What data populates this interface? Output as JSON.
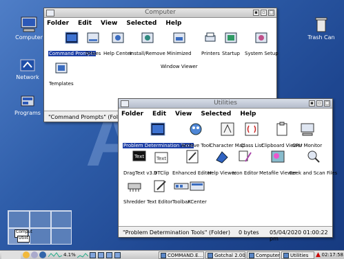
{
  "desktop": {
    "icons": [
      {
        "label": "Computer"
      },
      {
        "label": "Network"
      },
      {
        "label": "Programs"
      },
      {
        "label": "Trash Can"
      }
    ]
  },
  "computer_window": {
    "title": "Computer",
    "menu": [
      "Folder",
      "Edit",
      "View",
      "Selected",
      "Help"
    ],
    "objects": [
      {
        "label": "Command Prompts",
        "icon": "folder-icon",
        "selected": true
      },
      {
        "label": "Drives",
        "icon": "drives-icon"
      },
      {
        "label": "Help Center",
        "icon": "help-center-icon"
      },
      {
        "label": "Install/Remove",
        "icon": "install-remove-icon"
      },
      {
        "label": "Minimized",
        "label2": "Window Viewer",
        "icon": "minimized-window-viewer-icon"
      },
      {
        "label": "Printers",
        "icon": "printers-icon"
      },
      {
        "label": "Startup",
        "icon": "startup-icon"
      },
      {
        "label": "System Setup",
        "icon": "system-setup-icon"
      },
      {
        "label": "Templates",
        "icon": "templates-icon"
      }
    ],
    "status": "\"Command Prompts\" (Folder)"
  },
  "utilities_window": {
    "title": "Utilities",
    "menu": [
      "Folder",
      "Edit",
      "View",
      "Selected",
      "Help"
    ],
    "objects": [
      {
        "label": "Problem Determination Tools",
        "icon": "folder-icon",
        "selected": true
      },
      {
        "label": "Archive Tool",
        "icon": "archive-tool-icon"
      },
      {
        "label": "Character Map",
        "icon": "character-map-icon"
      },
      {
        "label": "Class List",
        "icon": "class-list-icon"
      },
      {
        "label": "Clipboard Viewer",
        "icon": "clipboard-viewer-icon"
      },
      {
        "label": "CPU Monitor",
        "icon": "cpu-monitor-icon"
      },
      {
        "label": "DragText v3.9",
        "icon": "dragtext-icon"
      },
      {
        "label": "DTClip",
        "icon": "dtclip-icon"
      },
      {
        "label": "Enhanced Editor",
        "icon": "enhanced-editor-icon"
      },
      {
        "label": "Help Viewer",
        "icon": "help-viewer-icon"
      },
      {
        "label": "Icon Editor",
        "icon": "icon-editor-icon"
      },
      {
        "label": "Metafile Viewer",
        "icon": "metafile-viewer-icon"
      },
      {
        "label": "Seek and Scan Files",
        "icon": "seek-scan-icon"
      },
      {
        "label": "Shredder",
        "icon": "shredder-icon"
      },
      {
        "label": "Text Editor",
        "icon": "text-editor-icon"
      },
      {
        "label": "Toolbar",
        "icon": "toolbar-icon"
      },
      {
        "label": "XCenter",
        "icon": "xcenter-icon"
      }
    ],
    "status_left": "\"Problem Determination Tools\" (Folder)",
    "status_size": "0 bytes",
    "status_date": "05/04/2020 01:00:22 pm",
    "title_icon_text": "Text",
    "text_glyph": "Text"
  },
  "pager": {
    "windows": [
      "Comput",
      "Utilit"
    ]
  },
  "taskbar": {
    "cpu": "4.1%",
    "tasks": [
      "COMMAND.E...",
      "Gotchal 2.00",
      "Computer",
      "Utilities"
    ],
    "clock": "02:17:58 pm"
  }
}
